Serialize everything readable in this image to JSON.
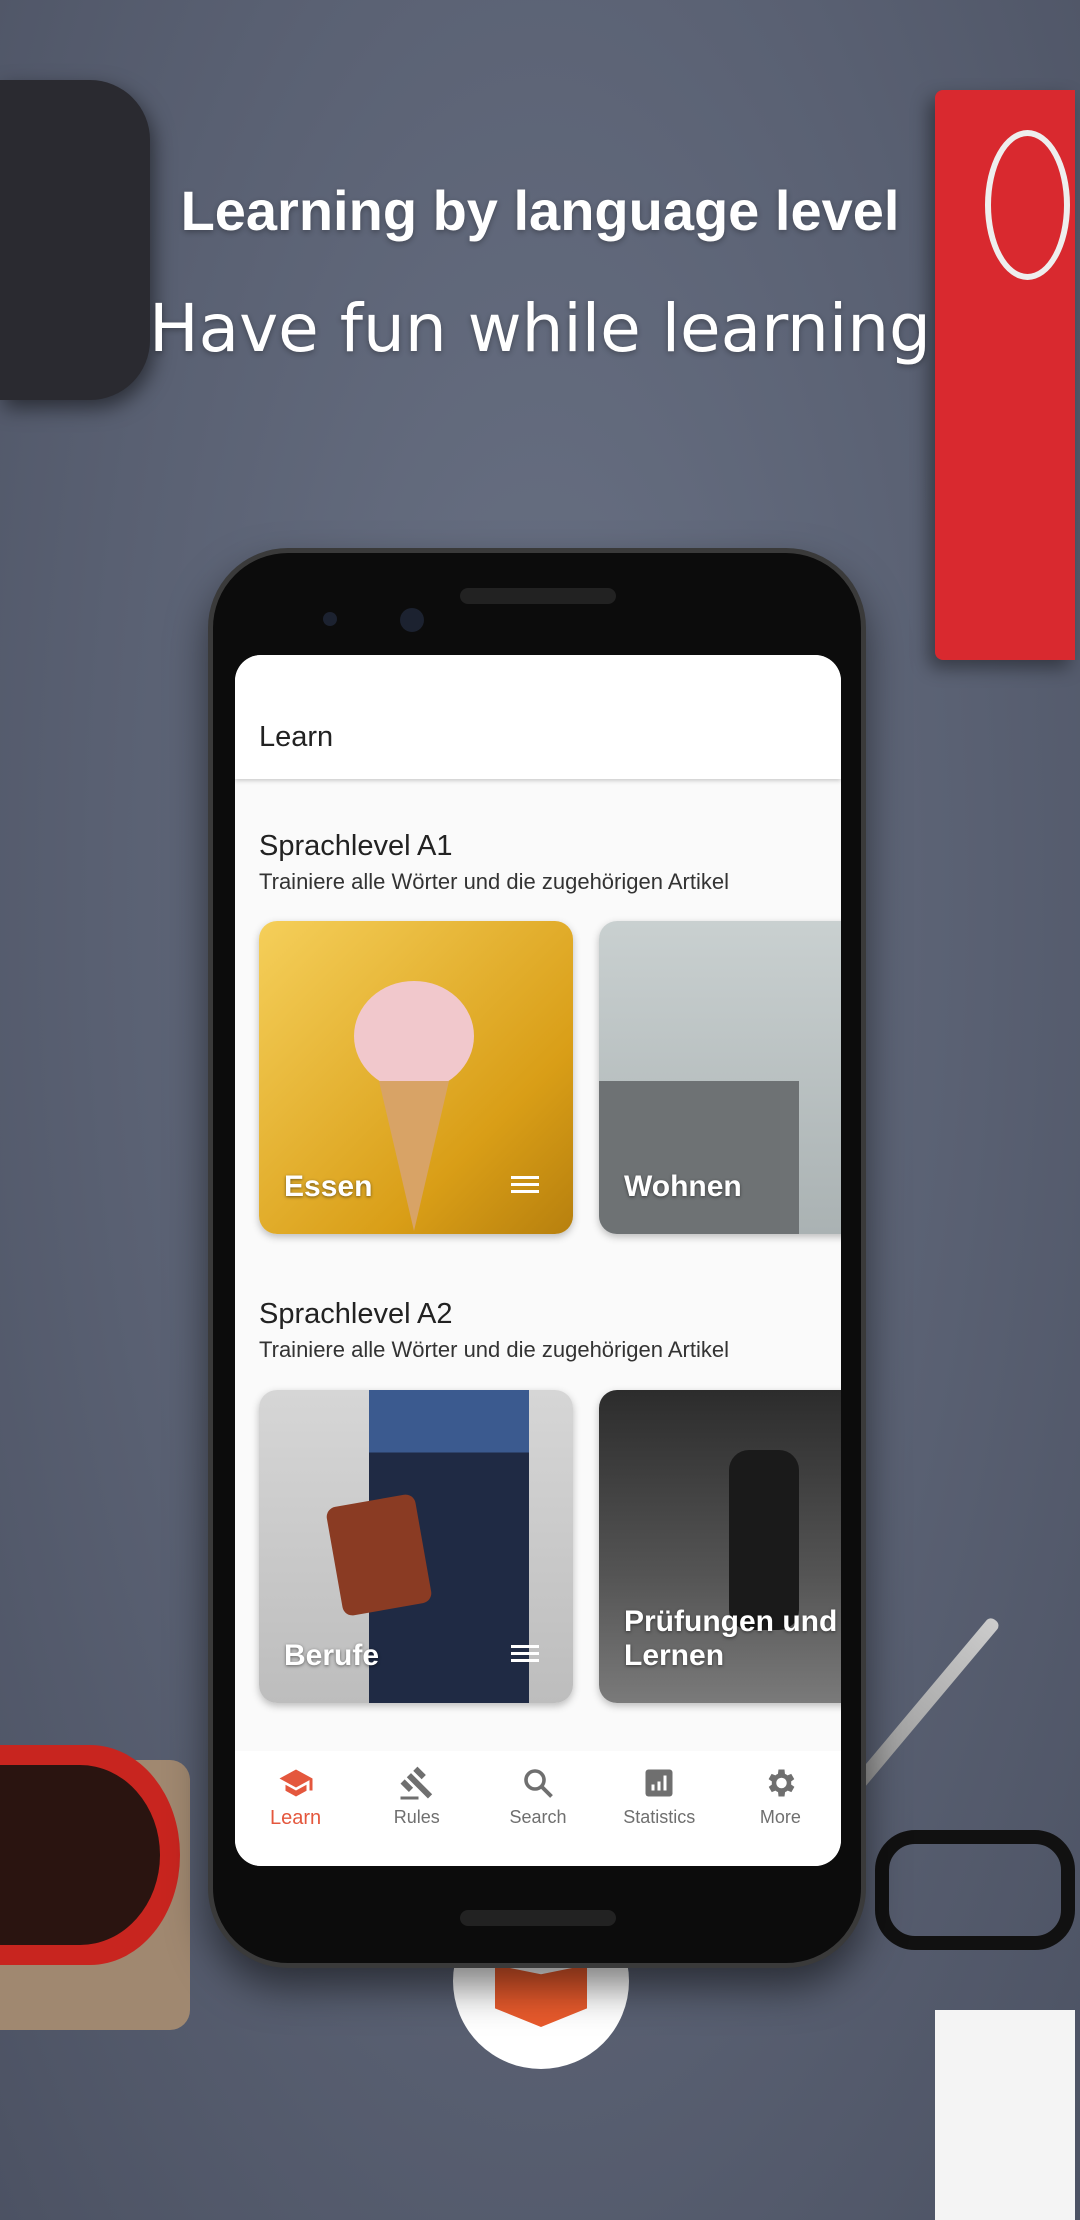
{
  "promo": {
    "headline": "Learning by language level",
    "subheadline": "Have fun while learning"
  },
  "colors": {
    "accent": "#e4573d",
    "background": "#5a6173",
    "inactive": "#6f6f6f"
  },
  "app": {
    "title": "Learn",
    "sections": [
      {
        "title": "Sprachlevel A1",
        "subtitle": "Trainiere alle Wörter und die zugehörigen Artikel",
        "cards": [
          {
            "label": "Essen",
            "icon": "list-icon"
          },
          {
            "label": "Wohnen"
          }
        ]
      },
      {
        "title": "Sprachlevel A2",
        "subtitle": "Trainiere alle Wörter und die zugehörigen Artikel",
        "cards": [
          {
            "label": "Berufe",
            "icon": "list-icon"
          },
          {
            "label": "Prüfungen und Lernen"
          }
        ]
      }
    ],
    "nav": [
      {
        "label": "Learn",
        "icon": "graduation-cap-icon",
        "active": true
      },
      {
        "label": "Rules",
        "icon": "gavel-icon"
      },
      {
        "label": "Search",
        "icon": "search-icon"
      },
      {
        "label": "Statistics",
        "icon": "bar-chart-icon"
      },
      {
        "label": "More",
        "icon": "gear-icon"
      }
    ]
  }
}
